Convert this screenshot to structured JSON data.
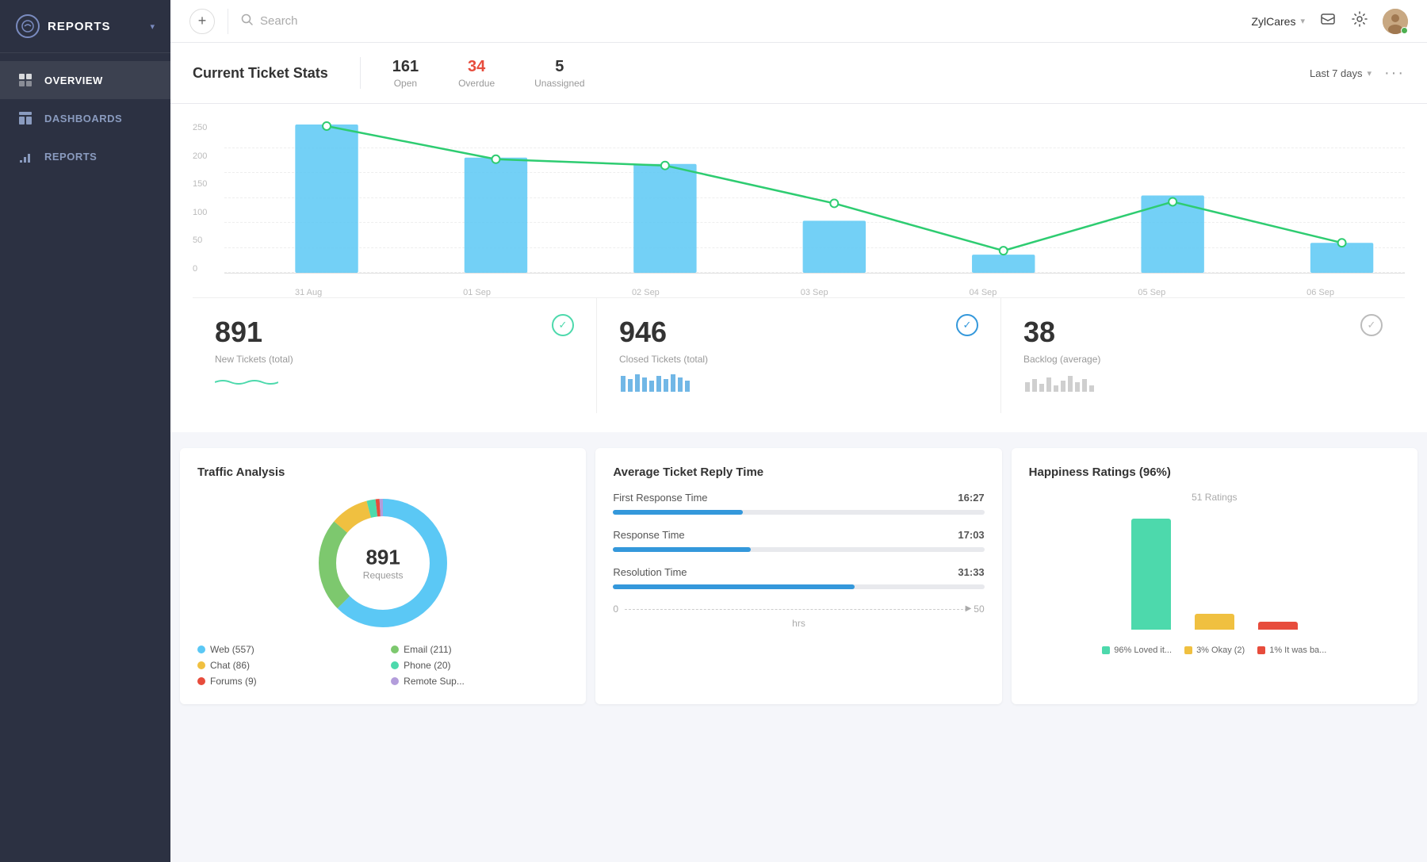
{
  "sidebar": {
    "title": "REPORTS",
    "nav": [
      {
        "id": "overview",
        "label": "OVERVIEW",
        "active": true
      },
      {
        "id": "dashboards",
        "label": "DASHBOARDS",
        "active": false
      },
      {
        "id": "reports",
        "label": "REPORTS",
        "active": false
      }
    ]
  },
  "topbar": {
    "add_label": "+",
    "search_placeholder": "Search",
    "user": "ZylCares",
    "period": "Last 7 days"
  },
  "ticket_stats": {
    "title": "Current Ticket Stats",
    "open": {
      "value": "161",
      "label": "Open"
    },
    "overdue": {
      "value": "34",
      "label": "Overdue"
    },
    "unassigned": {
      "value": "5",
      "label": "Unassigned"
    },
    "period": "Last 7 days"
  },
  "chart": {
    "y_labels": [
      "0",
      "50",
      "100",
      "150",
      "200",
      "250"
    ],
    "x_labels": [
      "31 Aug",
      "01 Sep",
      "02 Sep",
      "03 Sep",
      "04 Sep",
      "05 Sep",
      "06 Sep"
    ]
  },
  "stat_cards": [
    {
      "id": "new-tickets",
      "number": "891",
      "label": "New Tickets (total)",
      "type": "wave"
    },
    {
      "id": "closed-tickets",
      "number": "946",
      "label": "Closed Tickets (total)",
      "type": "bar"
    },
    {
      "id": "backlog",
      "number": "38",
      "label": "Backlog (average)",
      "type": "bar"
    }
  ],
  "traffic_analysis": {
    "title": "Traffic Analysis",
    "center_number": "891",
    "center_label": "Requests",
    "legend": [
      {
        "label": "Web (557)",
        "color": "#5bc8f5"
      },
      {
        "label": "Email (211)",
        "color": "#7dc86e"
      },
      {
        "label": "Chat (86)",
        "color": "#f0c040"
      },
      {
        "label": "Phone (20)",
        "color": "#4dd9ac"
      },
      {
        "label": "Forums (9)",
        "color": "#e74c3c"
      },
      {
        "label": "Remote Sup...",
        "color": "#b39ddb"
      }
    ]
  },
  "reply_time": {
    "title": "Average Ticket Reply Time",
    "items": [
      {
        "label": "First Response Time",
        "time": "16:27",
        "bar_pct": 35
      },
      {
        "label": "Response Time",
        "time": "17:03",
        "bar_pct": 37
      },
      {
        "label": "Resolution Time",
        "time": "31:33",
        "bar_pct": 65
      }
    ],
    "scale_start": "0",
    "scale_end": "50",
    "unit": "hrs"
  },
  "happiness": {
    "title": "Happiness Ratings (96%)",
    "subtitle": "51 Ratings",
    "bars": [
      {
        "label": "Loved",
        "color": "#4dd9ac",
        "height": 140,
        "pct": 96
      },
      {
        "label": "Okay",
        "color": "#f0c040",
        "height": 20,
        "pct": 3
      },
      {
        "label": "Bad",
        "color": "#e74c3c",
        "height": 10,
        "pct": 1
      }
    ],
    "legend": [
      {
        "label": "96% Loved it...",
        "color": "#4dd9ac"
      },
      {
        "label": "3% Okay (2)",
        "color": "#f0c040"
      },
      {
        "label": "1% It was ba...",
        "color": "#e74c3c"
      }
    ]
  }
}
